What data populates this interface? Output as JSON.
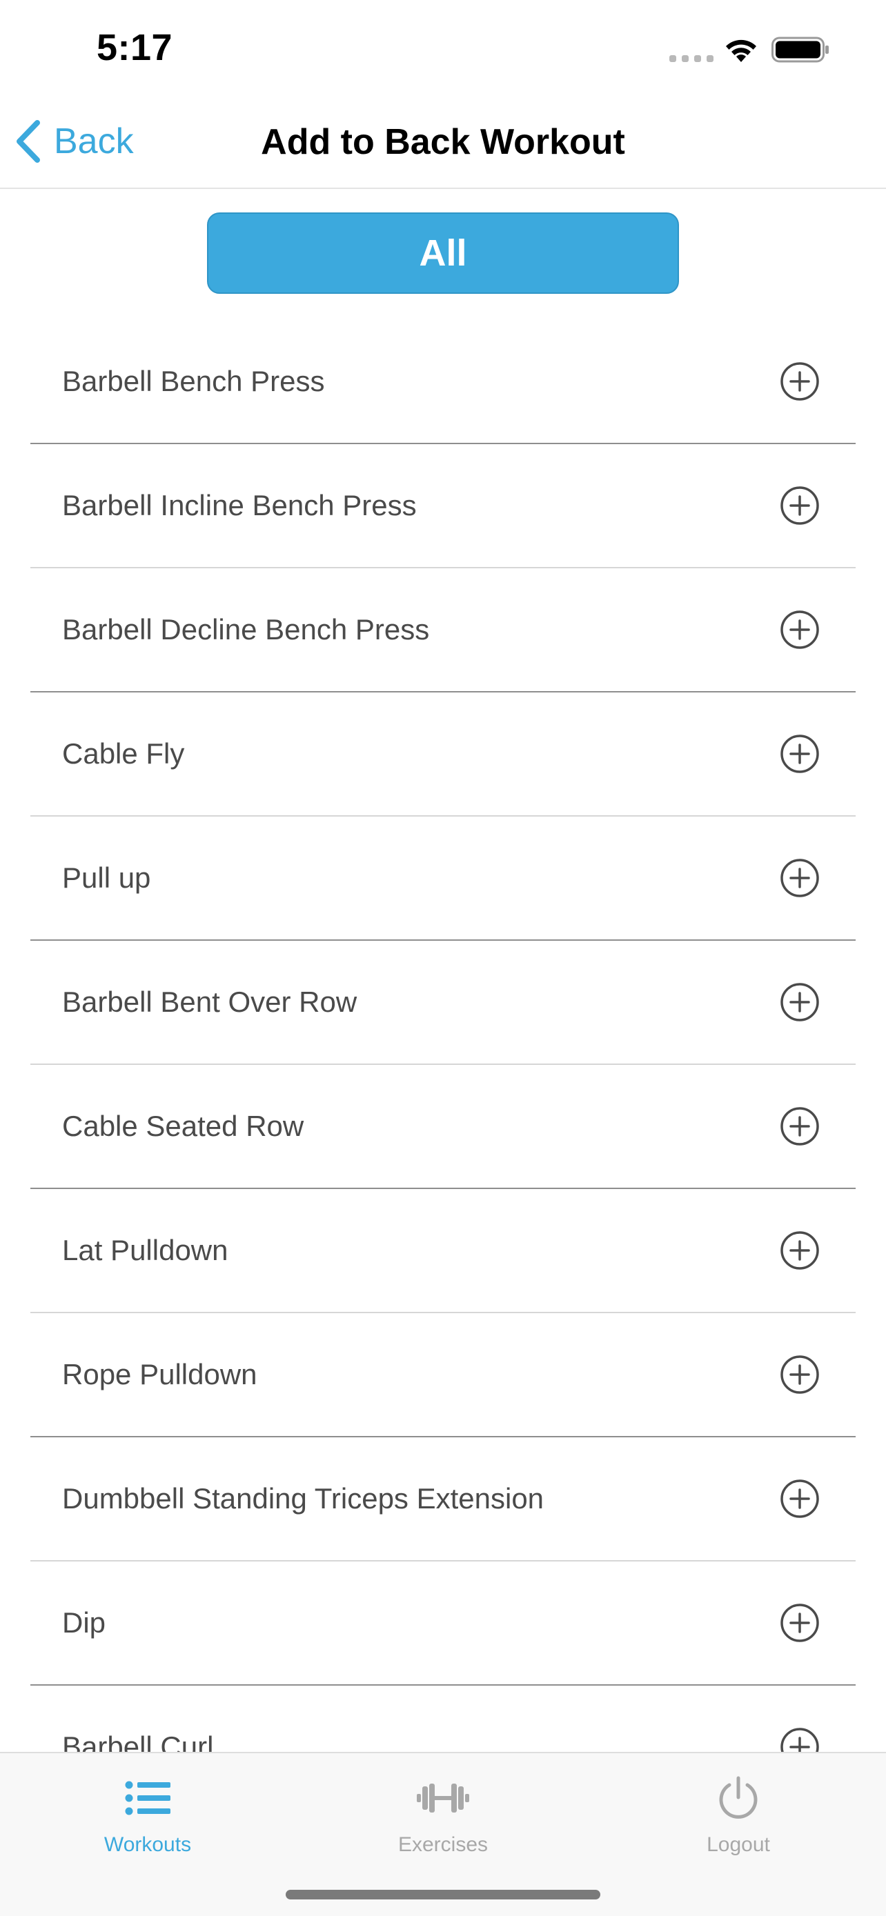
{
  "status_bar": {
    "time": "5:17"
  },
  "nav": {
    "back_label": "Back",
    "title": "Add to Back Workout"
  },
  "filter": {
    "label": "All"
  },
  "exercises": [
    {
      "label": "Barbell Bench Press",
      "icon": "plus-circle-icon"
    },
    {
      "label": "Barbell Incline Bench Press",
      "icon": "plus-circle-icon"
    },
    {
      "label": "Barbell Decline Bench Press",
      "icon": "plus-circle-icon"
    },
    {
      "label": "Cable Fly",
      "icon": "plus-circle-icon"
    },
    {
      "label": "Pull up",
      "icon": "plus-circle-icon"
    },
    {
      "label": "Barbell Bent Over Row",
      "icon": "plus-circle-icon"
    },
    {
      "label": "Cable Seated Row",
      "icon": "plus-circle-icon"
    },
    {
      "label": "Lat Pulldown",
      "icon": "plus-circle-icon"
    },
    {
      "label": "Rope Pulldown",
      "icon": "plus-circle-icon"
    },
    {
      "label": "Dumbbell Standing Triceps Extension",
      "icon": "plus-circle-icon"
    },
    {
      "label": "Dip",
      "icon": "plus-circle-icon"
    },
    {
      "label": "Barbell Curl",
      "icon": "plus-circle-icon"
    }
  ],
  "tabs": [
    {
      "label": "Workouts",
      "icon": "list-icon",
      "active": true
    },
    {
      "label": "Exercises",
      "icon": "dumbbell-icon",
      "active": false
    },
    {
      "label": "Logout",
      "icon": "power-icon",
      "active": false
    }
  ],
  "colors": {
    "accent": "#3ca9dd",
    "text": "#4a4a4a",
    "inactive_tab": "#a8a8a8"
  }
}
